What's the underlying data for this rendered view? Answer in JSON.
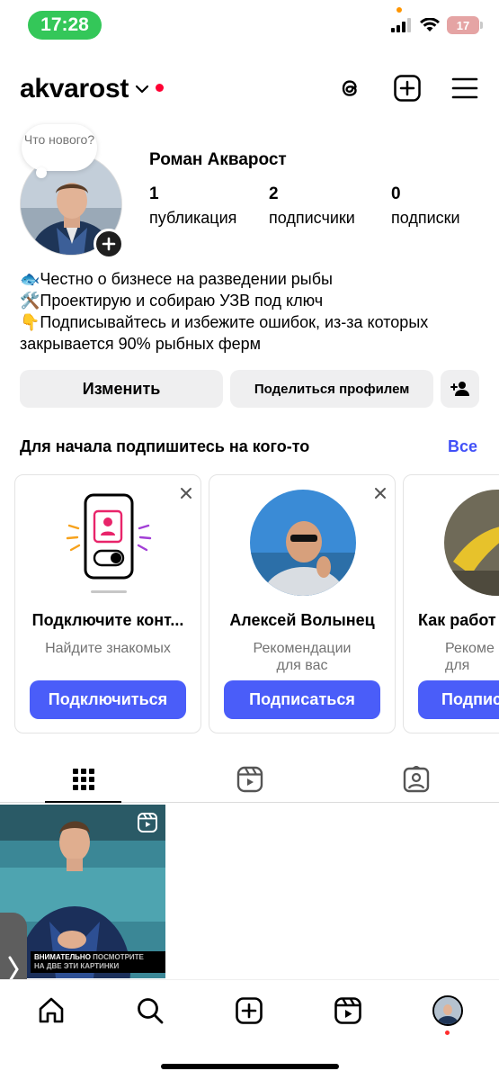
{
  "status_bar": {
    "time": "17:28",
    "battery": "17"
  },
  "header": {
    "username": "akvarost"
  },
  "profile": {
    "note": "Что нового?",
    "full_name": "Роман Акварост",
    "stats": [
      {
        "value": "1",
        "label": "публикация"
      },
      {
        "value": "2",
        "label": "подписчики"
      },
      {
        "value": "0",
        "label": "подписки"
      }
    ],
    "bio": [
      "🐟Честно о бизнесе на разведении рыбы",
      "🛠️Проектирую и собираю УЗВ под ключ",
      "👇Подписывайтесь и избежите ошибок, из-за которых",
      "закрывается 90% рыбных ферм"
    ]
  },
  "actions": {
    "edit": "Изменить",
    "share": "Поделиться профилем"
  },
  "suggestions": {
    "title": "Для начала подпишитесь на кого-то",
    "see_all": "Все",
    "cards": [
      {
        "title": "Подключите конт...",
        "subtitle": "Найдите знакомых",
        "button": "Подключиться"
      },
      {
        "title": "Алексей Волынец",
        "subtitle": "Рекомендации для вас",
        "button": "Подписаться"
      },
      {
        "title": "Как работ",
        "subtitle": "Рекоме для",
        "button": "Подпис"
      }
    ]
  },
  "post": {
    "caption_highlight": "Внимательно",
    "caption_rest": " посмотрите",
    "caption_line2": "на две эти картинки"
  },
  "colors": {
    "accent": "#4a5df9",
    "link": "#4150f7",
    "live_dot": "#ff0033",
    "time_pill": "#34c759"
  }
}
